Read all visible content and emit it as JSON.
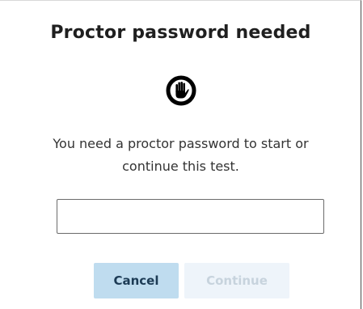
{
  "dialog": {
    "title": "Proctor password needed",
    "icon": "hand-stop-icon",
    "message_line1": "You need a proctor password to start or",
    "message_line2": "continue this test.",
    "password_input": {
      "value": "",
      "placeholder": ""
    },
    "buttons": {
      "cancel_label": "Cancel",
      "continue_label": "Continue",
      "continue_disabled": true
    },
    "colors": {
      "cancel_bg": "#bfdcef",
      "continue_bg_disabled": "#eef4fa",
      "icon": "#000000"
    }
  }
}
